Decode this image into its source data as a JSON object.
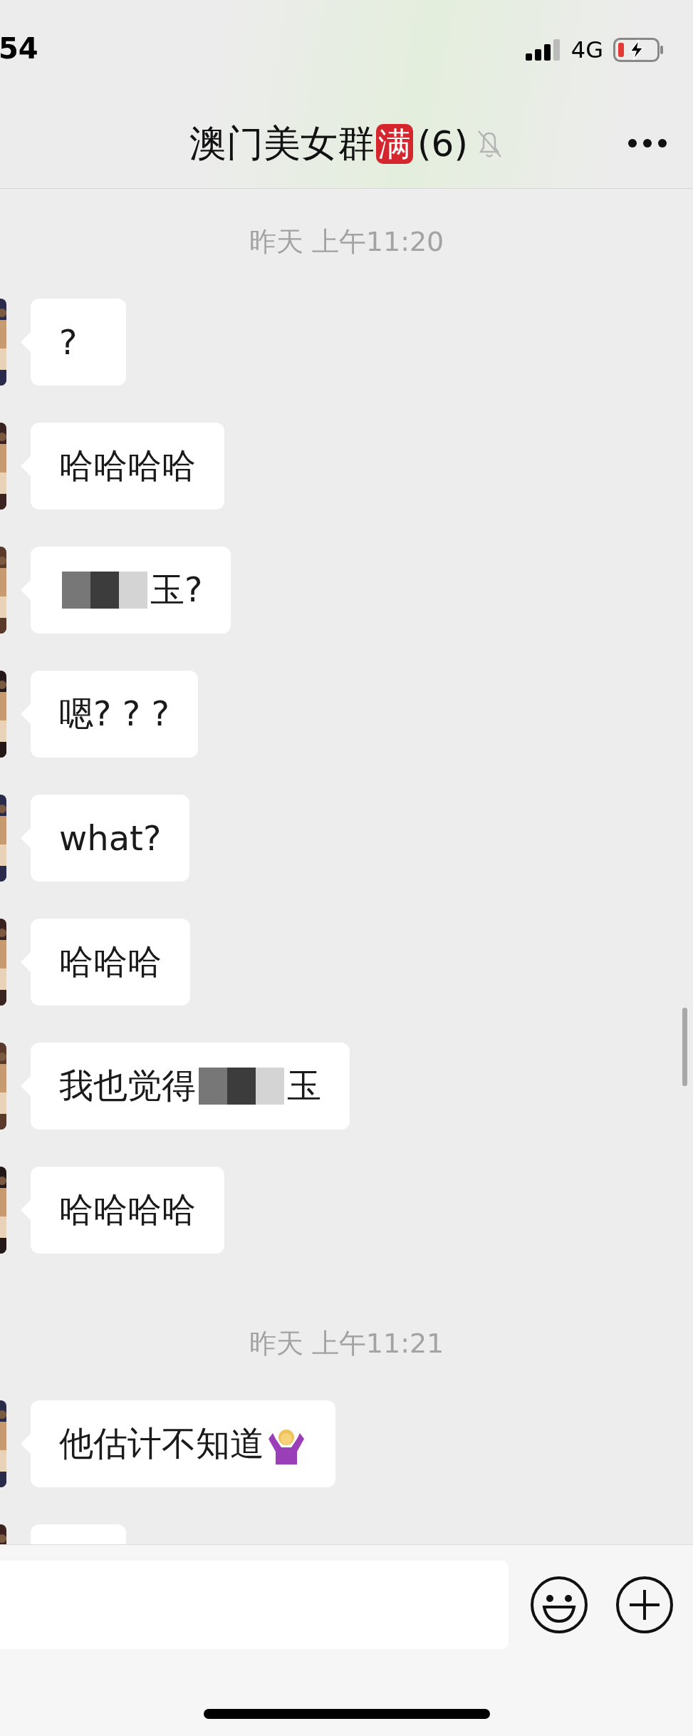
{
  "status_bar": {
    "time": "54",
    "network": "4G",
    "battery_charging": true
  },
  "header": {
    "title": "澳门美女群",
    "badge": "满",
    "member_count": "(6)",
    "muted": true
  },
  "chat": [
    {
      "kind": "time",
      "text": "昨天 上午11:20"
    },
    {
      "kind": "message",
      "parts": [
        {
          "kind": "text",
          "text": "?"
        }
      ]
    },
    {
      "kind": "message",
      "parts": [
        {
          "kind": "text",
          "text": "哈哈哈哈"
        }
      ]
    },
    {
      "kind": "message",
      "parts": [
        {
          "kind": "redaction"
        },
        {
          "kind": "text",
          "text": "玉?"
        }
      ]
    },
    {
      "kind": "message",
      "parts": [
        {
          "kind": "text",
          "text": "嗯? ? ?"
        }
      ]
    },
    {
      "kind": "message",
      "parts": [
        {
          "kind": "text",
          "text": "what?"
        }
      ]
    },
    {
      "kind": "message",
      "parts": [
        {
          "kind": "text",
          "text": "哈哈哈"
        }
      ]
    },
    {
      "kind": "message",
      "parts": [
        {
          "kind": "text",
          "text": "我也觉得"
        },
        {
          "kind": "redaction"
        },
        {
          "kind": "text",
          "text": "玉"
        }
      ]
    },
    {
      "kind": "message",
      "parts": [
        {
          "kind": "text",
          "text": "哈哈哈哈"
        }
      ]
    },
    {
      "kind": "time",
      "text": "昨天 上午11:21"
    },
    {
      "kind": "message",
      "parts": [
        {
          "kind": "text",
          "text": "他估计不知道"
        },
        {
          "kind": "shrug"
        }
      ]
    },
    {
      "kind": "message"
    }
  ]
}
